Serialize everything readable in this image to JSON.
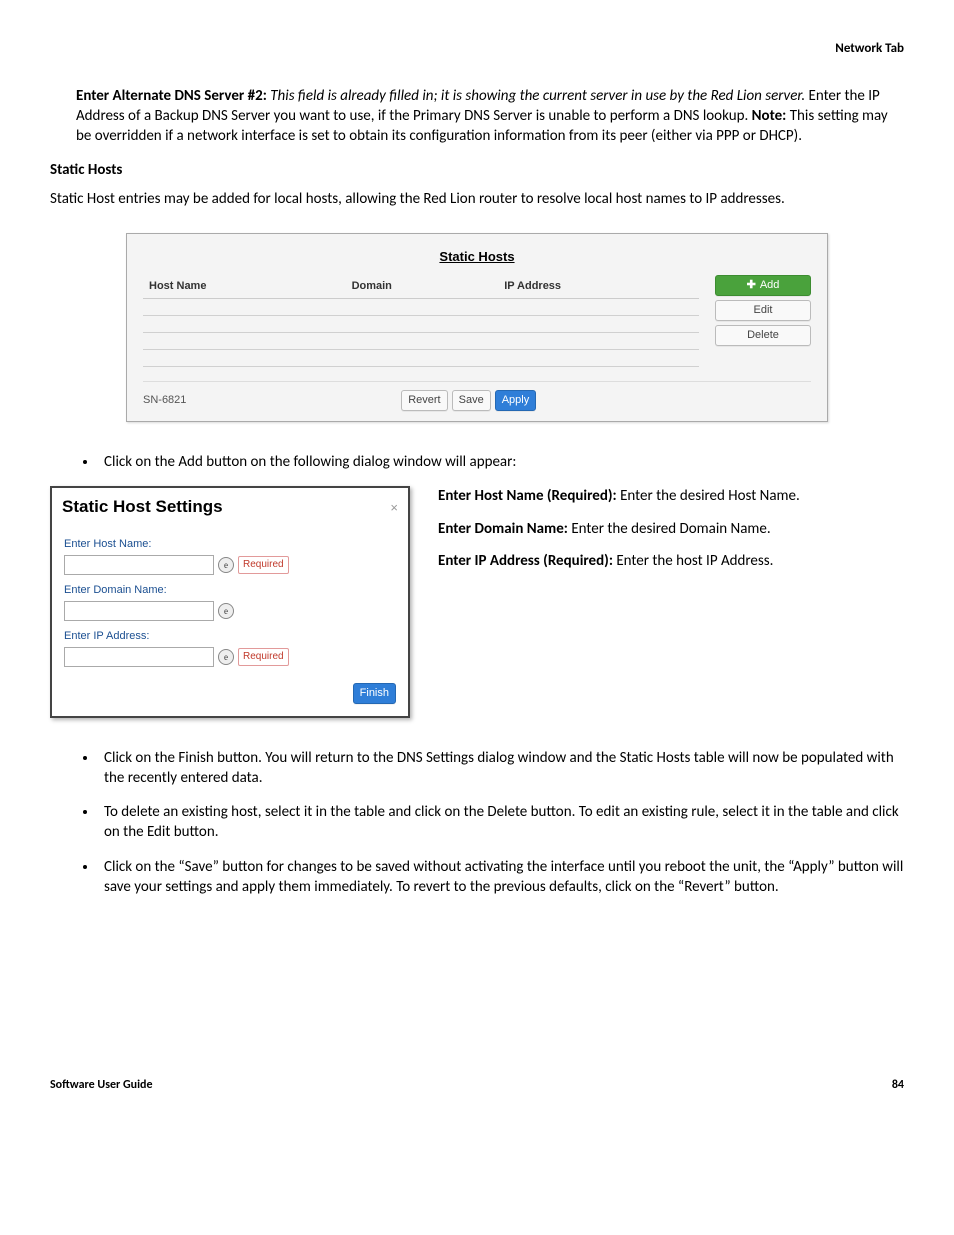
{
  "header": {
    "section": "Network Tab"
  },
  "p1": {
    "label": "Enter Alternate DNS Server #2:",
    "italic": " This field is already filled in; it is showing the current server in use by the Red Lion server.",
    "text1": " Enter the IP Address of a Backup DNS Server you want to use, if the Primary DNS Server is unable to perform a DNS lookup. ",
    "noteLabel": "Note:",
    "text2": " This setting may be overridden if a network interface is set to obtain its configuration information from its peer (either via PPP or DHCP)."
  },
  "staticHosts": {
    "heading": "Static Hosts",
    "sub": "Static Host entries may be added for local hosts, allowing the Red Lion router to resolve local host names to IP addresses."
  },
  "panel1": {
    "title": "Static Hosts",
    "col1": "Host Name",
    "col2": "Domain",
    "col3": "IP Address",
    "addBtn": "Add",
    "editBtn": "Edit",
    "deleteBtn": "Delete",
    "device": "SN-6821",
    "revert": "Revert",
    "save": "Save",
    "apply": "Apply"
  },
  "bullets1": {
    "b1": "Click on the Add button on the following dialog window will appear:"
  },
  "dialog": {
    "title": "Static Host Settings",
    "close": "×",
    "f1": "Enter Host Name:",
    "f2": "Enter Domain Name:",
    "f3": "Enter IP Address:",
    "req": "Required",
    "finish": "Finish"
  },
  "right": {
    "l1a": "Enter Host Name (Required):",
    "l1b": " Enter the desired Host Name.",
    "l2a": "Enter Domain Name:",
    "l2b": " Enter the desired Domain Name.",
    "l3a": "Enter IP Address (Required):",
    "l3b": " Enter the host IP Address."
  },
  "bullets2": {
    "b1": "Click on the Finish button. You will return to the DNS Settings dialog window and the Static Hosts table will now be populated with the recently entered data.",
    "b2": "To delete an existing host, select it in the table and click on the Delete button. To edit an existing rule, select it in the table and click on the Edit button.",
    "b3": "Click on the “Save” button for changes to be saved without activating the interface until you reboot the unit, the “Apply” button will save your settings and apply them immediately. To revert to the previous defaults, click on the “Revert” button."
  },
  "footer": {
    "left": "Software User Guide",
    "right": "84"
  }
}
